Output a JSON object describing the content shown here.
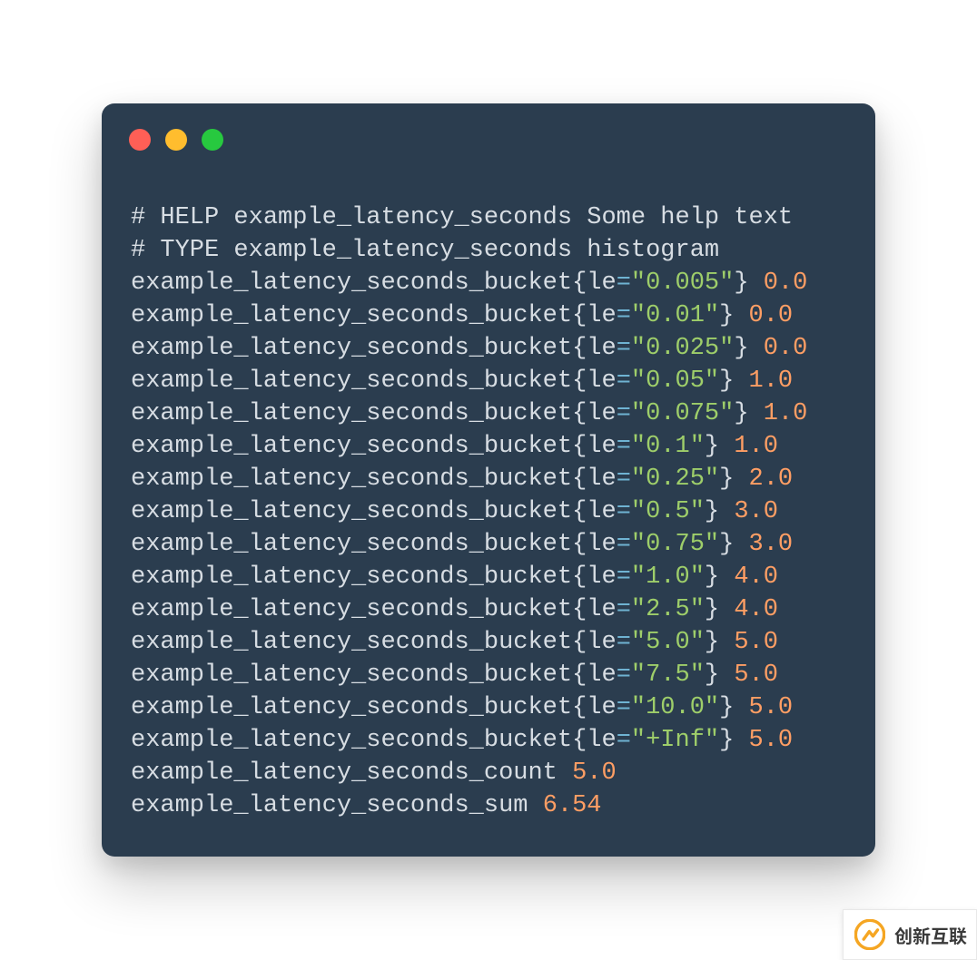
{
  "colors": {
    "card_bg": "#2b3d4f",
    "text": "#d7dde3",
    "eq": "#6fb3d2",
    "string": "#9ece6a",
    "number": "#ff9e64",
    "traffic_red": "#ff5f56",
    "traffic_yellow": "#ffbd2e",
    "traffic_green": "#27c93f"
  },
  "metric": {
    "name": "example_latency_seconds",
    "help_line": "# HELP example_latency_seconds Some help text",
    "type_line": "# TYPE example_latency_seconds histogram",
    "bucket_metric": "example_latency_seconds_bucket",
    "label_key": "le",
    "buckets": [
      {
        "le": "0.005",
        "value": "0.0"
      },
      {
        "le": "0.01",
        "value": "0.0"
      },
      {
        "le": "0.025",
        "value": "0.0"
      },
      {
        "le": "0.05",
        "value": "1.0"
      },
      {
        "le": "0.075",
        "value": "1.0"
      },
      {
        "le": "0.1",
        "value": "1.0"
      },
      {
        "le": "0.25",
        "value": "2.0"
      },
      {
        "le": "0.5",
        "value": "3.0"
      },
      {
        "le": "0.75",
        "value": "3.0"
      },
      {
        "le": "1.0",
        "value": "4.0"
      },
      {
        "le": "2.5",
        "value": "4.0"
      },
      {
        "le": "5.0",
        "value": "5.0"
      },
      {
        "le": "7.5",
        "value": "5.0"
      },
      {
        "le": "10.0",
        "value": "5.0"
      },
      {
        "le": "+Inf",
        "value": "5.0"
      }
    ],
    "count_metric": "example_latency_seconds_count",
    "count_value": "5.0",
    "sum_metric": "example_latency_seconds_sum",
    "sum_value": "6.54"
  },
  "watermark": {
    "text": "创新互联"
  }
}
